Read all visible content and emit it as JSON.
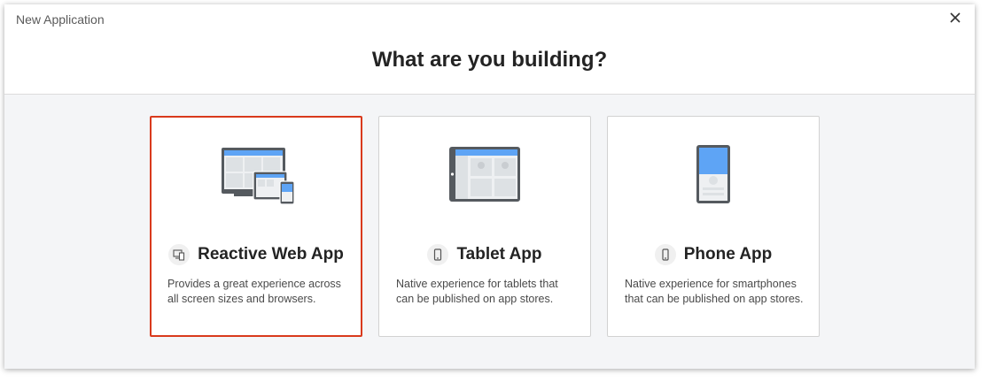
{
  "dialog": {
    "title": "New Application",
    "close_icon": "close-icon"
  },
  "heading": "What are you building?",
  "cards": [
    {
      "title": "Reactive Web App",
      "description": "Provides a great experience across all screen sizes and browsers.",
      "icon": "responsive-devices-icon",
      "selected": true
    },
    {
      "title": "Tablet App",
      "description": "Native experience for tablets that can be published on app stores.",
      "icon": "tablet-icon",
      "selected": false
    },
    {
      "title": "Phone App",
      "description": "Native experience for smartphones that can be published on app stores.",
      "icon": "phone-icon",
      "selected": false
    }
  ],
  "colors": {
    "selected_border": "#d93a1c",
    "screen_accent": "#5ea4f5",
    "device_frame": "#555a5f"
  }
}
